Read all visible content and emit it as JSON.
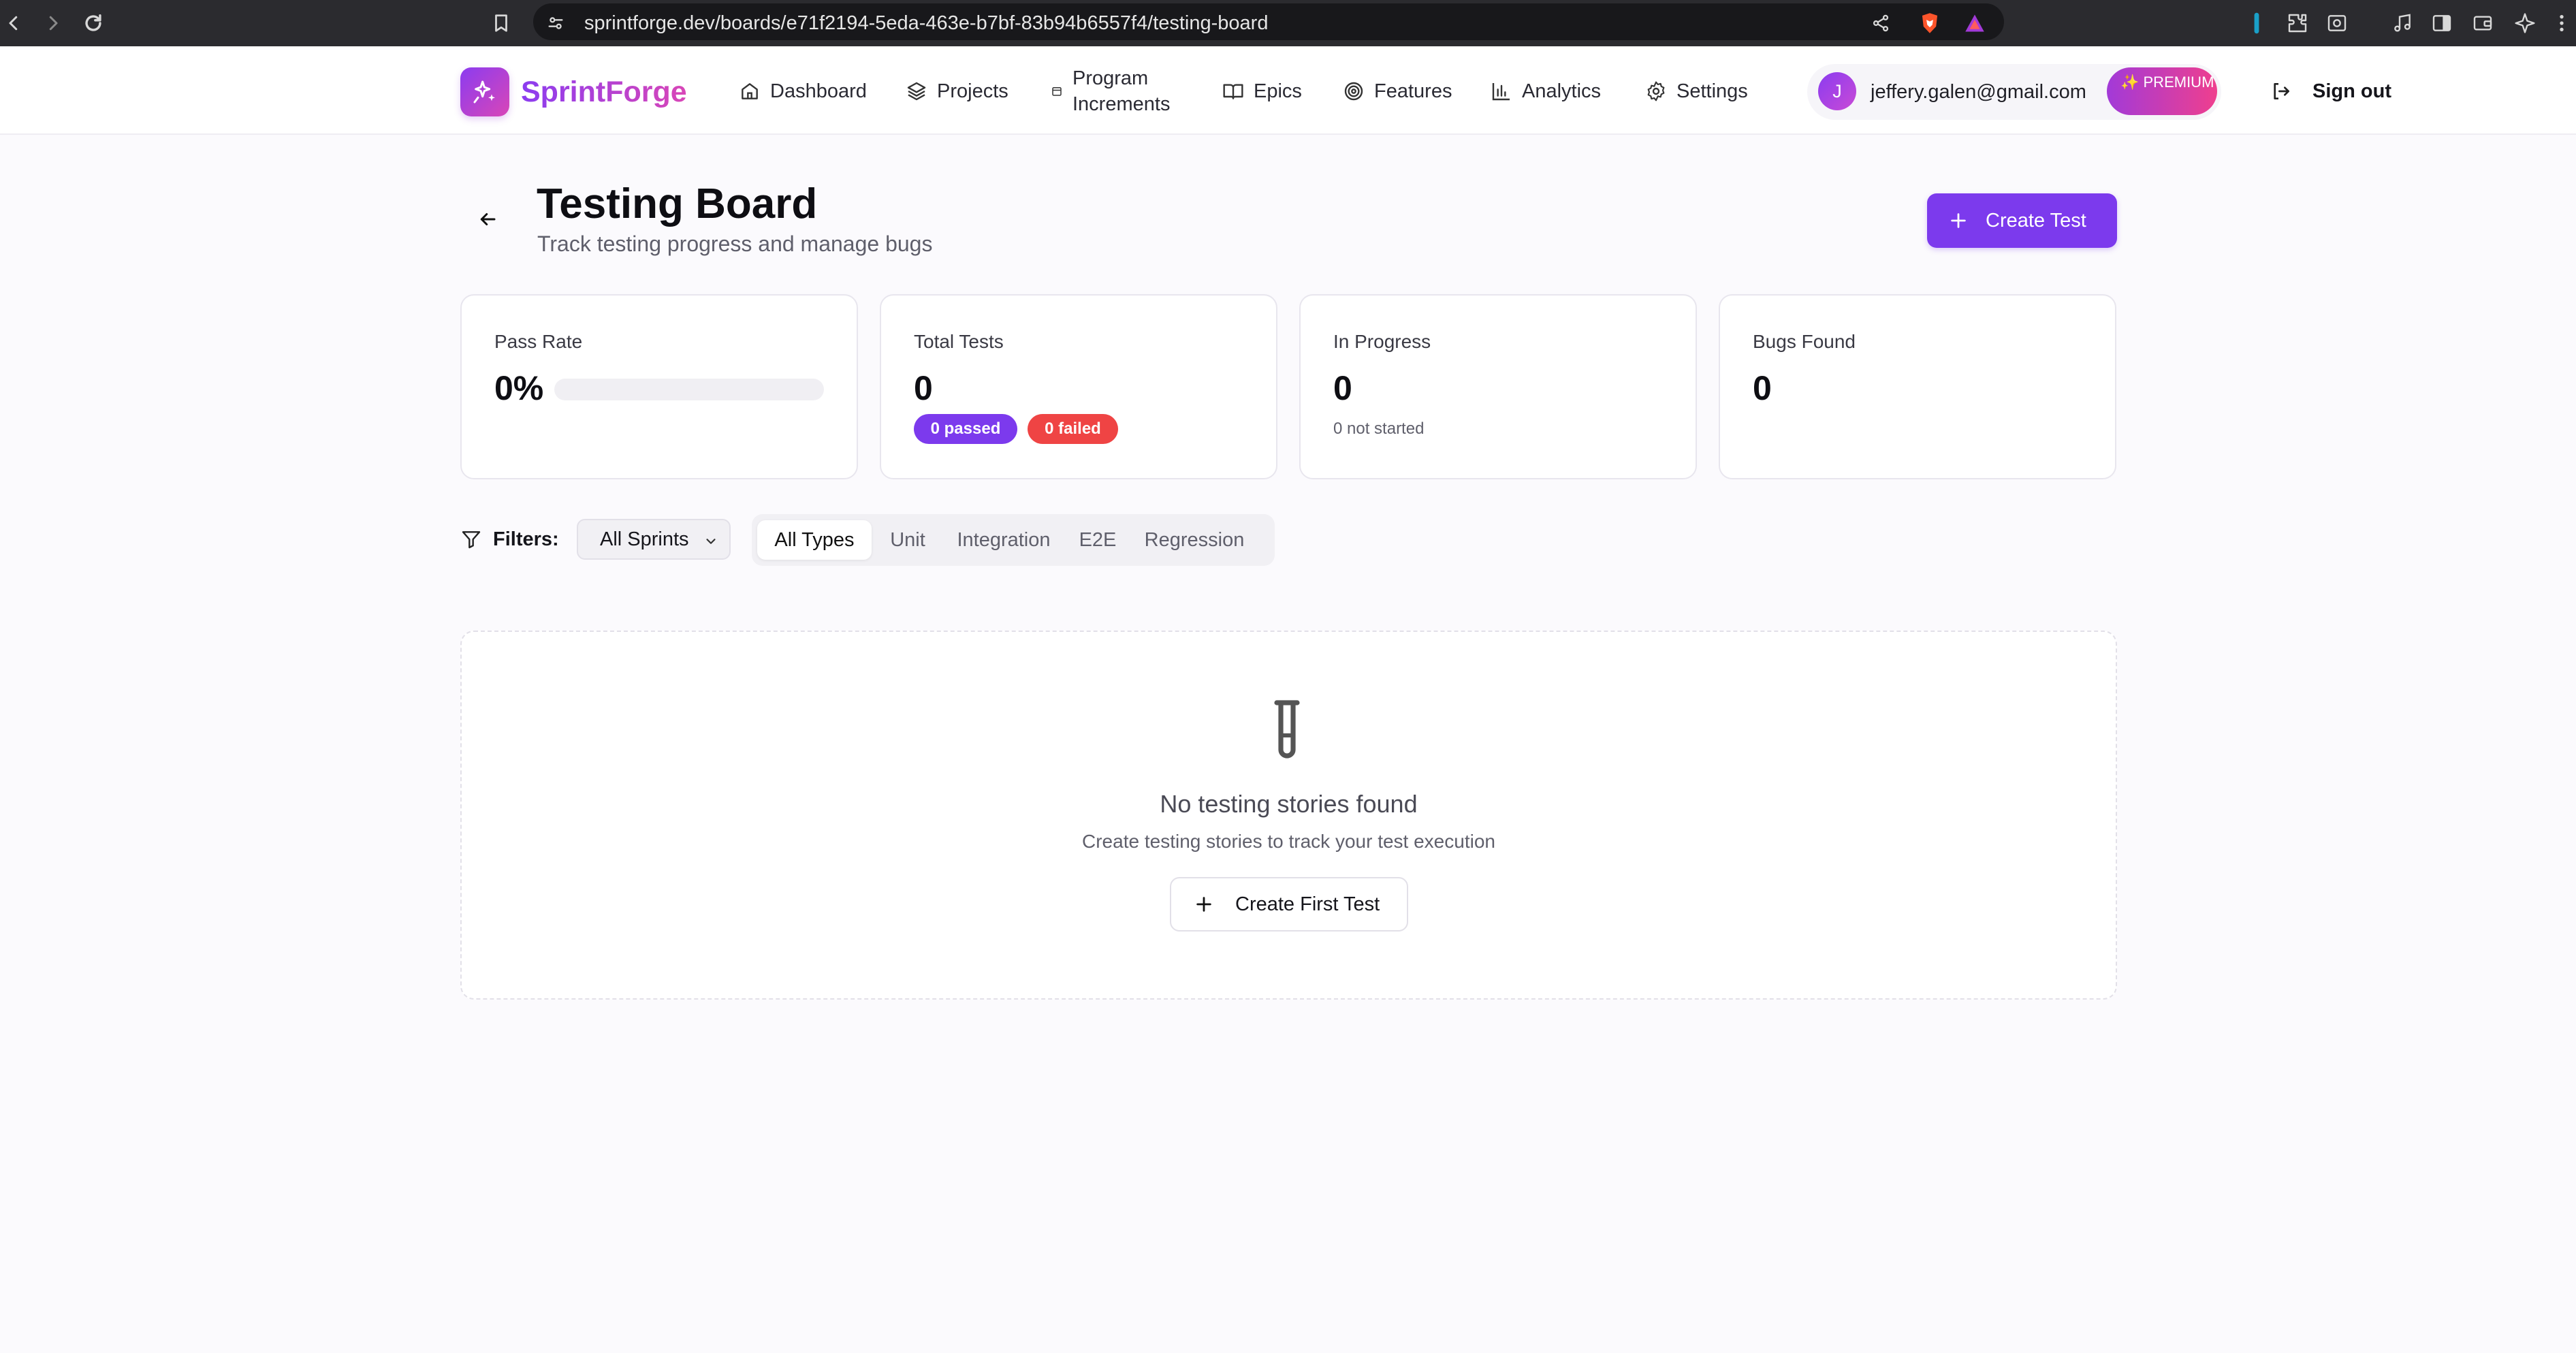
{
  "browser": {
    "url": "sprintforge.dev/boards/e71f2194-5eda-463e-b7bf-83b94b6557f4/testing-board"
  },
  "app": {
    "brand": "SprintForge",
    "nav": {
      "dashboard": "Dashboard",
      "projects": "Projects",
      "program_increments": "Program\nIncrements",
      "epics": "Epics",
      "features": "Features",
      "analytics": "Analytics",
      "settings": "Settings"
    },
    "user": {
      "initial": "J",
      "email": "jeffery.galen@gmail.com",
      "badge": "✨ PREMIUM"
    },
    "sign_out": "Sign out"
  },
  "page": {
    "title": "Testing Board",
    "subtitle": "Track testing progress and manage bugs",
    "create_button": "Create Test"
  },
  "stats": {
    "pass_rate": {
      "label": "Pass Rate",
      "value": "0%",
      "progress": 0
    },
    "total_tests": {
      "label": "Total Tests",
      "value": "0",
      "passed": "0 passed",
      "failed": "0 failed"
    },
    "in_progress": {
      "label": "In Progress",
      "value": "0",
      "sub": "0 not started"
    },
    "bugs_found": {
      "label": "Bugs Found",
      "value": "0"
    }
  },
  "filters": {
    "label": "Filters:",
    "sprint": "All Sprints",
    "types": [
      "All Types",
      "Unit",
      "Integration",
      "E2E",
      "Regression"
    ],
    "active_type": "All Types"
  },
  "empty_state": {
    "title": "No testing stories found",
    "subtitle": "Create testing stories to track your test execution",
    "button": "Create First Test"
  },
  "colors": {
    "accent": "#7c3aed",
    "danger": "#ef4444",
    "brand_gradient_start": "#8b3cf0",
    "brand_gradient_end": "#d946b7"
  }
}
